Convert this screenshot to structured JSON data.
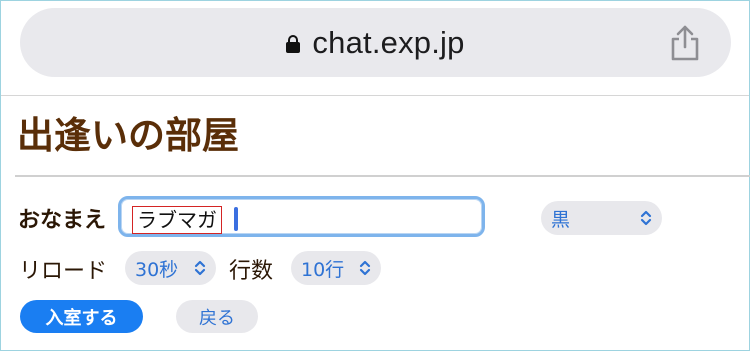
{
  "browser": {
    "url": "chat.exp.jp",
    "lock_icon": "lock-icon",
    "share_icon": "share-icon"
  },
  "page": {
    "title": "出逢いの部屋"
  },
  "form": {
    "name_label": "おなまえ",
    "name_value": "ラブマガ",
    "color_value": "黒",
    "reload_label": "リロード",
    "reload_value": "30秒",
    "lines_label": "行数",
    "lines_value": "10行",
    "enter_label": "入室する",
    "back_label": "戻る"
  },
  "colors": {
    "title": "#5a2e08",
    "accent": "#1a7ef2",
    "select_text": "#2f73d4",
    "highlight_box": "#d42424"
  }
}
